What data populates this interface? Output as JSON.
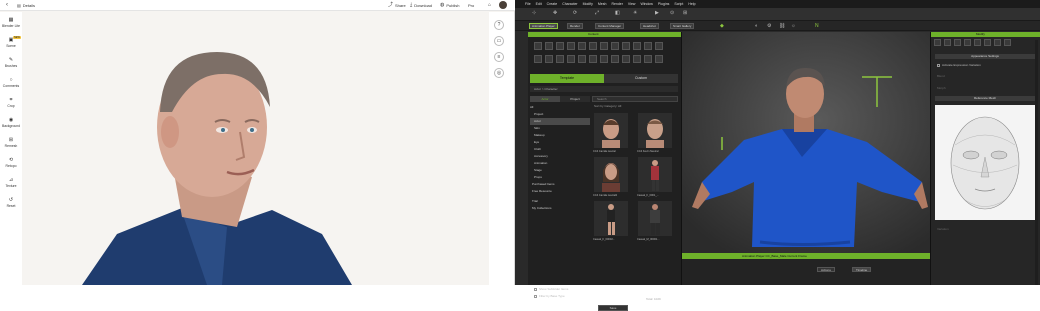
{
  "left_app": {
    "topbar": {
      "back_icon": "chevron-left-icon",
      "file_label": "Details",
      "actions": [
        {
          "label": "Share",
          "icon": "share-icon"
        },
        {
          "label": "Download",
          "icon": "download-icon"
        },
        {
          "label": "Publish",
          "icon": "globe-icon"
        },
        {
          "label": "Pro",
          "icon": "sparkle-icon"
        }
      ]
    },
    "sidebar": [
      {
        "label": "Blender Lite",
        "icon": "layers-icon",
        "badge": ""
      },
      {
        "label": "Scene",
        "icon": "scene-icon",
        "badge": "NEW"
      },
      {
        "label": "Brushes",
        "icon": "brush-icon",
        "badge": ""
      },
      {
        "label": "Comments",
        "icon": "comment-icon",
        "badge": ""
      },
      {
        "label": "Crop",
        "icon": "crop-icon",
        "badge": ""
      },
      {
        "label": "Background",
        "icon": "background-icon",
        "badge": ""
      },
      {
        "label": "Remesh",
        "icon": "grid-icon",
        "badge": ""
      },
      {
        "label": "Retopo",
        "icon": "retopo-icon",
        "badge": ""
      },
      {
        "label": "Texture",
        "icon": "texture-icon",
        "badge": ""
      },
      {
        "label": "Reset",
        "icon": "reset-icon",
        "badge": ""
      }
    ],
    "right_tools": [
      "help-icon",
      "chat-icon",
      "settings-icon",
      "target-icon"
    ]
  },
  "right_app": {
    "menubar": [
      "File",
      "Edit",
      "Create",
      "Character",
      "Modify",
      "Mesh",
      "Render",
      "View",
      "Window",
      "Plugins",
      "Script",
      "Help"
    ],
    "toolbar_tabs": [
      "Animation Player",
      "Render",
      "Content Manager",
      "Headshot",
      "Smart Gallery"
    ],
    "content_panel": {
      "title": "Content",
      "tabs": [
        "Template",
        "Custom"
      ],
      "path": "Actor > Character",
      "subtabs": [
        "Actor",
        "Project"
      ],
      "tree": [
        "All",
        "Project",
        "Actor",
        "Skin",
        "Makeup",
        "Eye",
        "Cloth",
        "Accessory",
        "Animation",
        "Stage",
        "Props",
        "Purchased Items",
        "Free Resource",
        "Trial",
        "My Collections"
      ],
      "search_placeholder": "Search",
      "filter_label": "Sort by Category: All",
      "items": [
        "CC4 Camila neutral",
        "CC4 Kevin Neutral",
        "CC4 Camila neutral2",
        "Casual_F_0001_...",
        "Casual_F_00002...",
        "Casual_M_00001..."
      ],
      "options": [
        "Show Subfolder Items",
        "Filter by Base Type"
      ],
      "save_button": "Save",
      "count": "Total: 1029"
    },
    "animation_bar": "Animation Player  CC_Base_Male  Current Frame",
    "timeline_buttons": [
      "Actions",
      "Timeline"
    ],
    "modify_panel": {
      "title": "Modify",
      "section1": "Appearance Settings",
      "checkbox": "Activate Expression Variation",
      "section2": "Reference Mesh",
      "faded": [
        "Blend",
        "Morph",
        "Variation"
      ]
    },
    "colors": {
      "accent": "#6eb12a",
      "left_bg": "#f6f4f1",
      "jacket": "#1f3c6e",
      "shirt": "#1f55c8"
    }
  }
}
